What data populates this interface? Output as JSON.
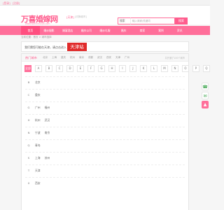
{
  "topbar": {
    "login": "[登录]",
    "register": "[注册]"
  },
  "logo": {
    "name": "万喜婚嫁网",
    "sub": "www.wanxihunjia.com",
    "city_tag": "[天津]",
    "switch": "[切换城市]"
  },
  "search": {
    "select": "搜索",
    "placeholder": "输入商家/关键词",
    "button": "搜索"
  },
  "nav": [
    "首页",
    "婚纱摄影",
    "婚宴酒店",
    "婚庆公司",
    "婚纱礼服",
    "婚庆",
    "商家",
    "案例",
    "资讯"
  ],
  "breadcrumb": "当前位置：首页 > 城市选择",
  "banner": {
    "text": "我们猜您可能在天津，请点击进入",
    "city": "天津站"
  },
  "panel": {
    "title": "热门城市",
    "hot": [
      "北京",
      "上海",
      "重庆",
      "杭州",
      "南京",
      "成都",
      "武汉",
      "西安",
      "天津",
      "广州"
    ],
    "more": "共开通了100个城市",
    "letters": [
      "全部",
      "A",
      "B",
      "C",
      "D",
      "E",
      "F",
      "G",
      "H",
      "I",
      "J",
      "K",
      "L",
      "M",
      "N",
      "O",
      "P",
      "Q",
      "R",
      "S",
      "T",
      "W",
      "X",
      "Y",
      "Z"
    ],
    "groups": [
      {
        "letter": "B",
        "cities": [
          "北京"
        ]
      },
      {
        "letter": "C",
        "cities": [
          "重庆"
        ]
      },
      {
        "letter": "G",
        "cities": [
          "广州",
          "福州"
        ]
      },
      {
        "letter": "H",
        "cities": [
          "杭州",
          "武汉"
        ]
      },
      {
        "letter": "N",
        "cities": [
          "宁波",
          "南京"
        ]
      },
      {
        "letter": "Q",
        "cities": [
          "青岛"
        ]
      },
      {
        "letter": "S",
        "cities": [
          "上海",
          "苏州"
        ]
      },
      {
        "letter": "T",
        "cities": [
          "天津"
        ]
      },
      {
        "letter": "X",
        "cities": [
          "西安"
        ]
      }
    ]
  },
  "colors": {
    "brand": "#ff6f9a",
    "accent": "#e02a2a"
  }
}
